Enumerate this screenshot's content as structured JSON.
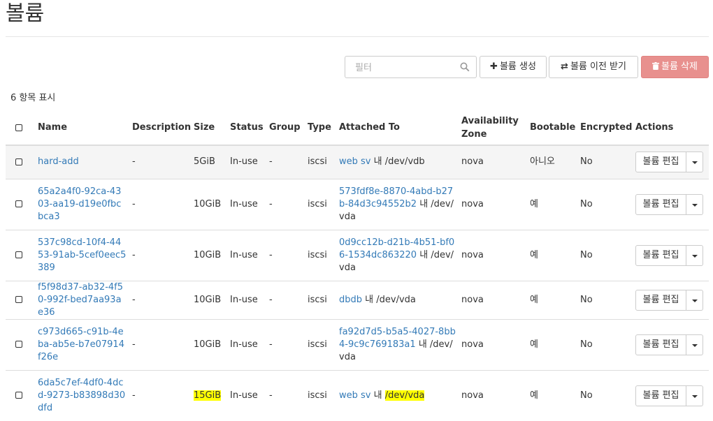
{
  "page": {
    "title": "볼륨"
  },
  "toolbar": {
    "filter_placeholder": "필터",
    "create_label": "볼륨 생성",
    "transfer_label": "볼륨 이전 받기",
    "delete_label": "볼륨 삭제"
  },
  "summary": {
    "count_label": "6 항목 표시"
  },
  "table": {
    "columns": {
      "name": "Name",
      "description": "Description",
      "size": "Size",
      "status": "Status",
      "group": "Group",
      "type": "Type",
      "attached_to": "Attached To",
      "availability_zone": "Availability Zone",
      "bootable": "Bootable",
      "encrypted": "Encrypted",
      "actions": "Actions"
    },
    "rows": [
      {
        "name": "hard-add",
        "description": "-",
        "size": "5GiB",
        "status": "In-use",
        "group": "-",
        "type": "iscsi",
        "attached_server": "web sv",
        "attached_sep": "내",
        "attached_device": "/dev/vdb",
        "zone": "nova",
        "bootable": "아니오",
        "encrypted": "No",
        "action": "볼륨 편집"
      },
      {
        "name": "65a2a4f0-92ca-4303-aa19-d19e0fbcbca3",
        "description": "-",
        "size": "10GiB",
        "status": "In-use",
        "group": "-",
        "type": "iscsi",
        "attached_server": "573fdf8e-8870-4abd-b27b-84d3c94552b2",
        "attached_sep": "내",
        "attached_device": "/dev/vda",
        "zone": "nova",
        "bootable": "예",
        "encrypted": "No",
        "action": "볼륨 편집"
      },
      {
        "name": "537c98cd-10f4-4453-91ab-5cef0eec5389",
        "description": "-",
        "size": "10GiB",
        "status": "In-use",
        "group": "-",
        "type": "iscsi",
        "attached_server": "0d9cc12b-d21b-4b51-bf06-1534dc863220",
        "attached_sep": "내",
        "attached_device": "/dev/vda",
        "zone": "nova",
        "bootable": "예",
        "encrypted": "No",
        "action": "볼륨 편집"
      },
      {
        "name": "f5f98d37-ab32-4f50-992f-bed7aa93ae36",
        "description": "-",
        "size": "10GiB",
        "status": "In-use",
        "group": "-",
        "type": "iscsi",
        "attached_server": "dbdb",
        "attached_sep": "내",
        "attached_device": "/dev/vda",
        "zone": "nova",
        "bootable": "예",
        "encrypted": "No",
        "action": "볼륨 편집"
      },
      {
        "name": "c973d665-c91b-4eba-ab5e-b7e07914f26e",
        "description": "-",
        "size": "10GiB",
        "status": "In-use",
        "group": "-",
        "type": "iscsi",
        "attached_server": "fa92d7d5-b5a5-4027-8bb4-9c9c769183a1",
        "attached_sep": "내",
        "attached_device": "/dev/vda",
        "zone": "nova",
        "bootable": "예",
        "encrypted": "No",
        "action": "볼륨 편집"
      },
      {
        "name": "6da5c7ef-4df0-4dcd-9273-b83898d30dfd",
        "description": "-",
        "size": "15GiB",
        "status": "In-use",
        "group": "-",
        "type": "iscsi",
        "attached_server": "web sv",
        "attached_sep": "내",
        "attached_device": "/dev/vda",
        "zone": "nova",
        "bootable": "예",
        "encrypted": "No",
        "action": "볼륨 편집"
      }
    ]
  },
  "colors": {
    "link": "#337ab7",
    "delete_button": "#e8908e",
    "highlight": "#ffff00"
  },
  "icons": {
    "create": "plus-icon",
    "transfer": "exchange-icon",
    "delete": "trash-icon",
    "filter": "search-icon"
  }
}
